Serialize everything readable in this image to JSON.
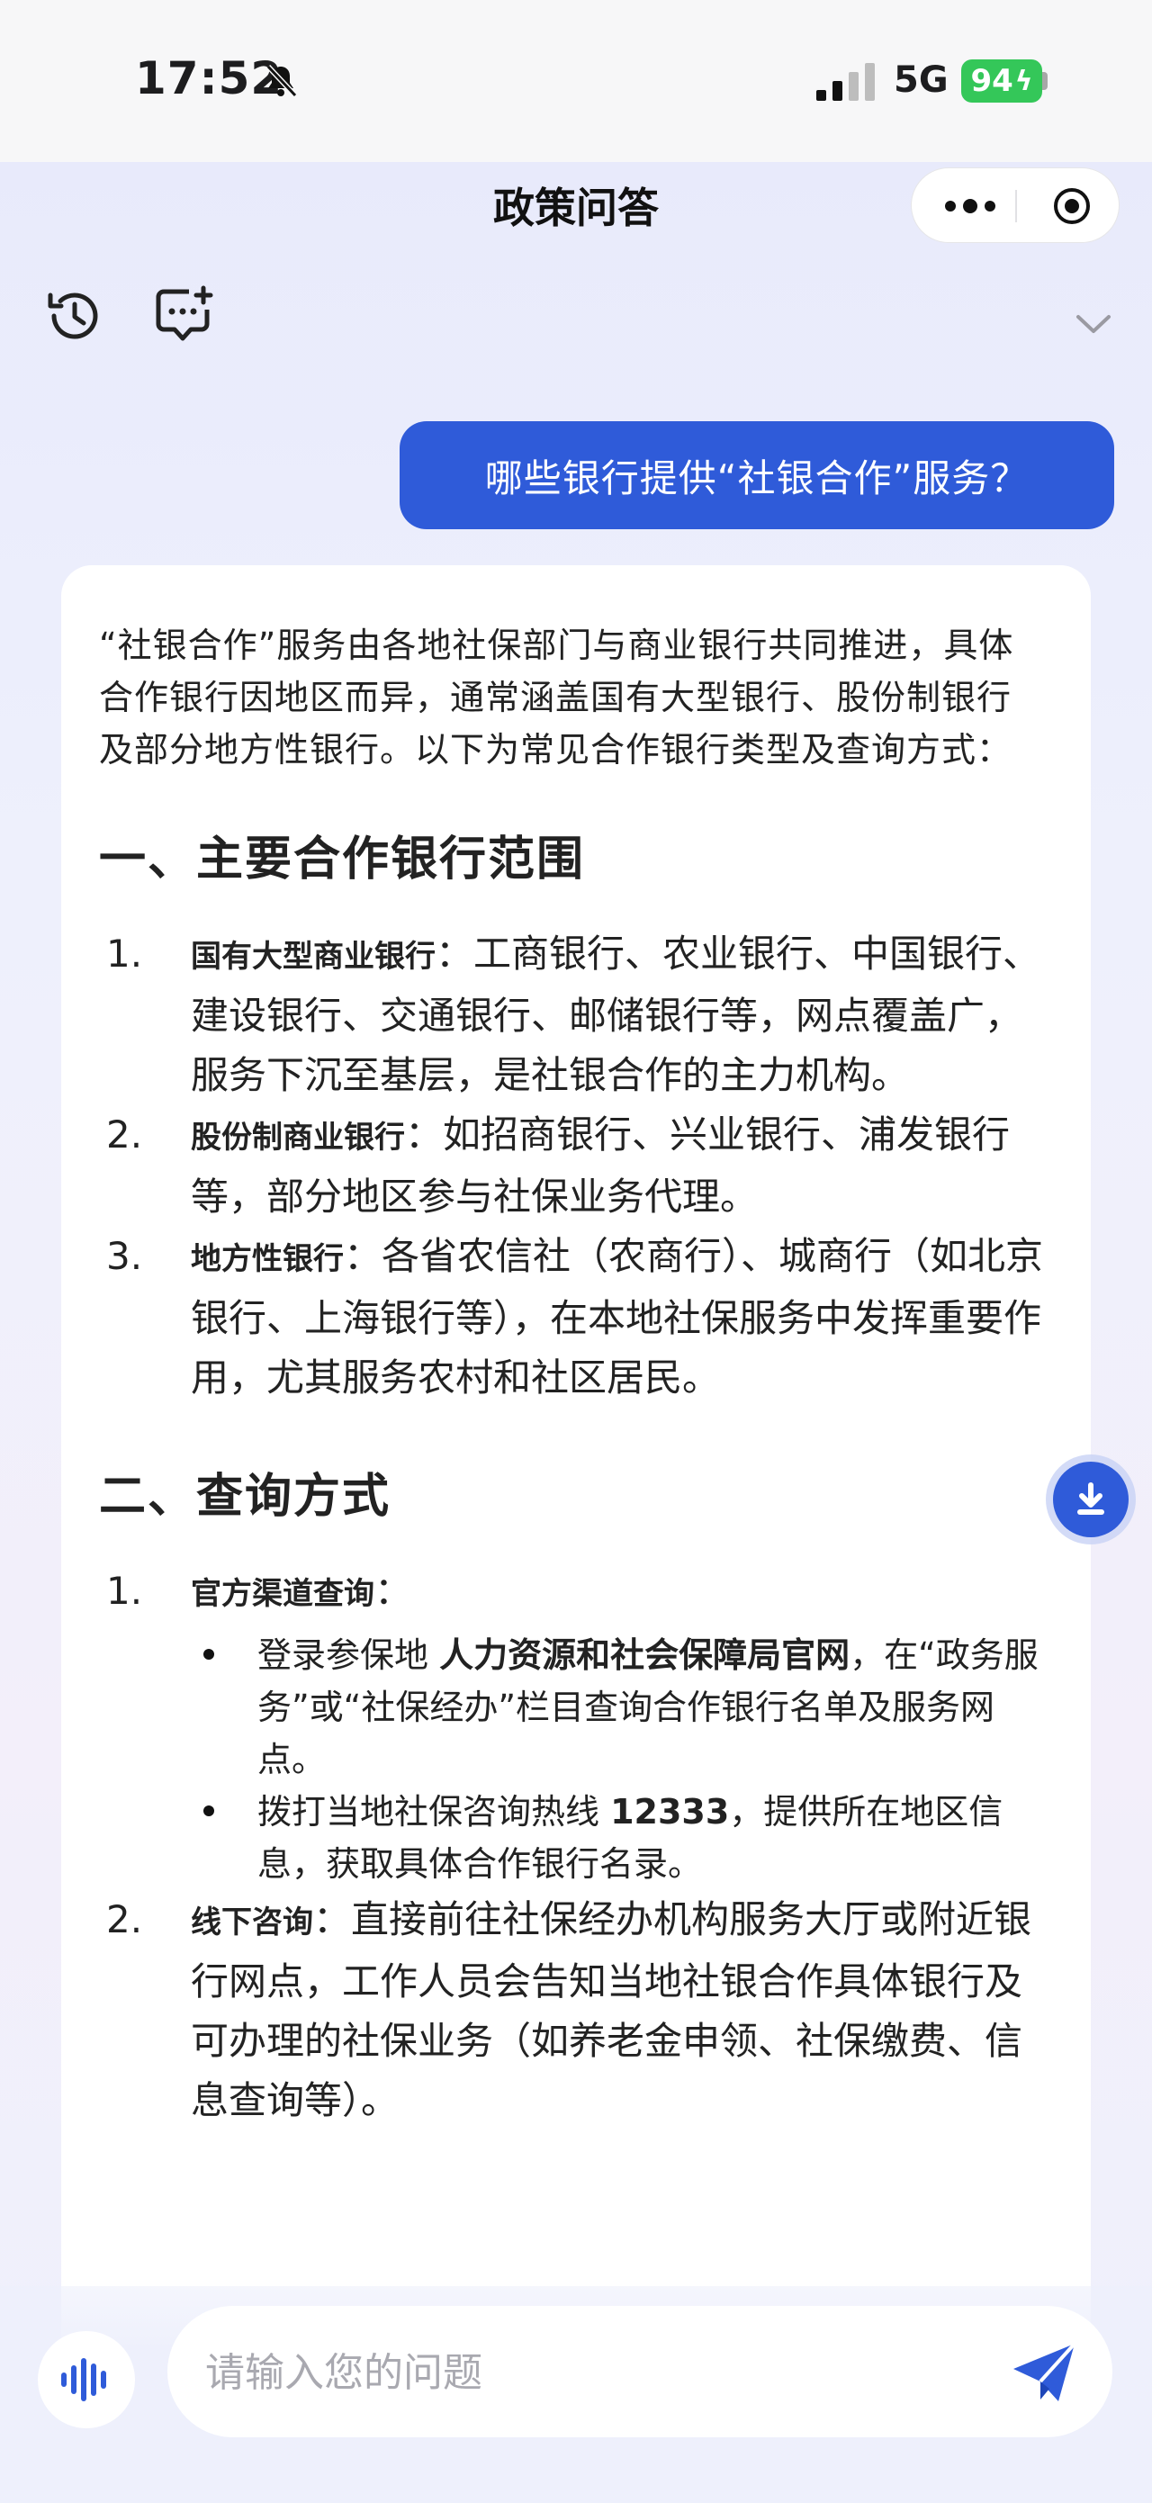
{
  "status_bar": {
    "time": "17:52",
    "network": "5G",
    "battery": "94"
  },
  "nav": {
    "title": "政策问答"
  },
  "chat": {
    "user_message": "哪些银行提供“社银合作”服务？",
    "answer": {
      "intro": "“社银合作”服务由各地社保部门与商业银行共同推进，具体合作银行因地区而异，通常涵盖国有大型银行、股份制银行及部分地方性银行。以下为常见合作银行类型及查询方式：",
      "section1": {
        "heading": "一、主要合作银行范围",
        "items": [
          {
            "num": "1.",
            "term": "国有大型商业银行",
            "text": "：工商银行、农业银行、中国银行、建设银行、交通银行、邮储银行等，网点覆盖广，服务下沉至基层，是社银合作的主力机构。"
          },
          {
            "num": "2.",
            "term": "股份制商业银行",
            "text": "：如招商银行、兴业银行、浦发银行等，部分地区参与社保业务代理。"
          },
          {
            "num": "3.",
            "term": "地方性银行",
            "text": "：各省农信社（农商行）、城商行（如北京银行、上海银行等），在本地社保服务中发挥重要作用，尤其服务农村和社区居民。"
          }
        ]
      },
      "section2": {
        "heading": "二、查询方式",
        "item1": {
          "num": "1.",
          "term": "官方渠道查询",
          "text": "：",
          "sub": [
            {
              "pre": "登录参保地 ",
              "bold": "人力资源和社会保障局官网",
              "post": "，在“政务服务”或“社保经办”栏目查询合作银行名单及服务网点。"
            },
            {
              "pre": "拨打当地社保咨询热线 ",
              "bold": "12333",
              "post": "，提供所在地区信息，获取具体合作银行名录。"
            }
          ]
        },
        "item2": {
          "num": "2.",
          "term": "线下咨询",
          "text": "：直接前往社保经办机构服务大厅或附近银行网点，工作人员会告知当地社银合作具体银行及可办理的社保业务（如养老金申领、社保缴费、信息查询等）。"
        }
      }
    }
  },
  "input": {
    "placeholder": "请输入您的问题"
  },
  "icons": {
    "history": "history-icon",
    "new_chat": "new-chat-icon",
    "collapse": "chevron-down-icon",
    "download": "download-icon",
    "voice": "voice-wave-icon",
    "send": "send-icon"
  },
  "colors": {
    "accent": "#2f5bd9",
    "battery": "#34c759"
  }
}
